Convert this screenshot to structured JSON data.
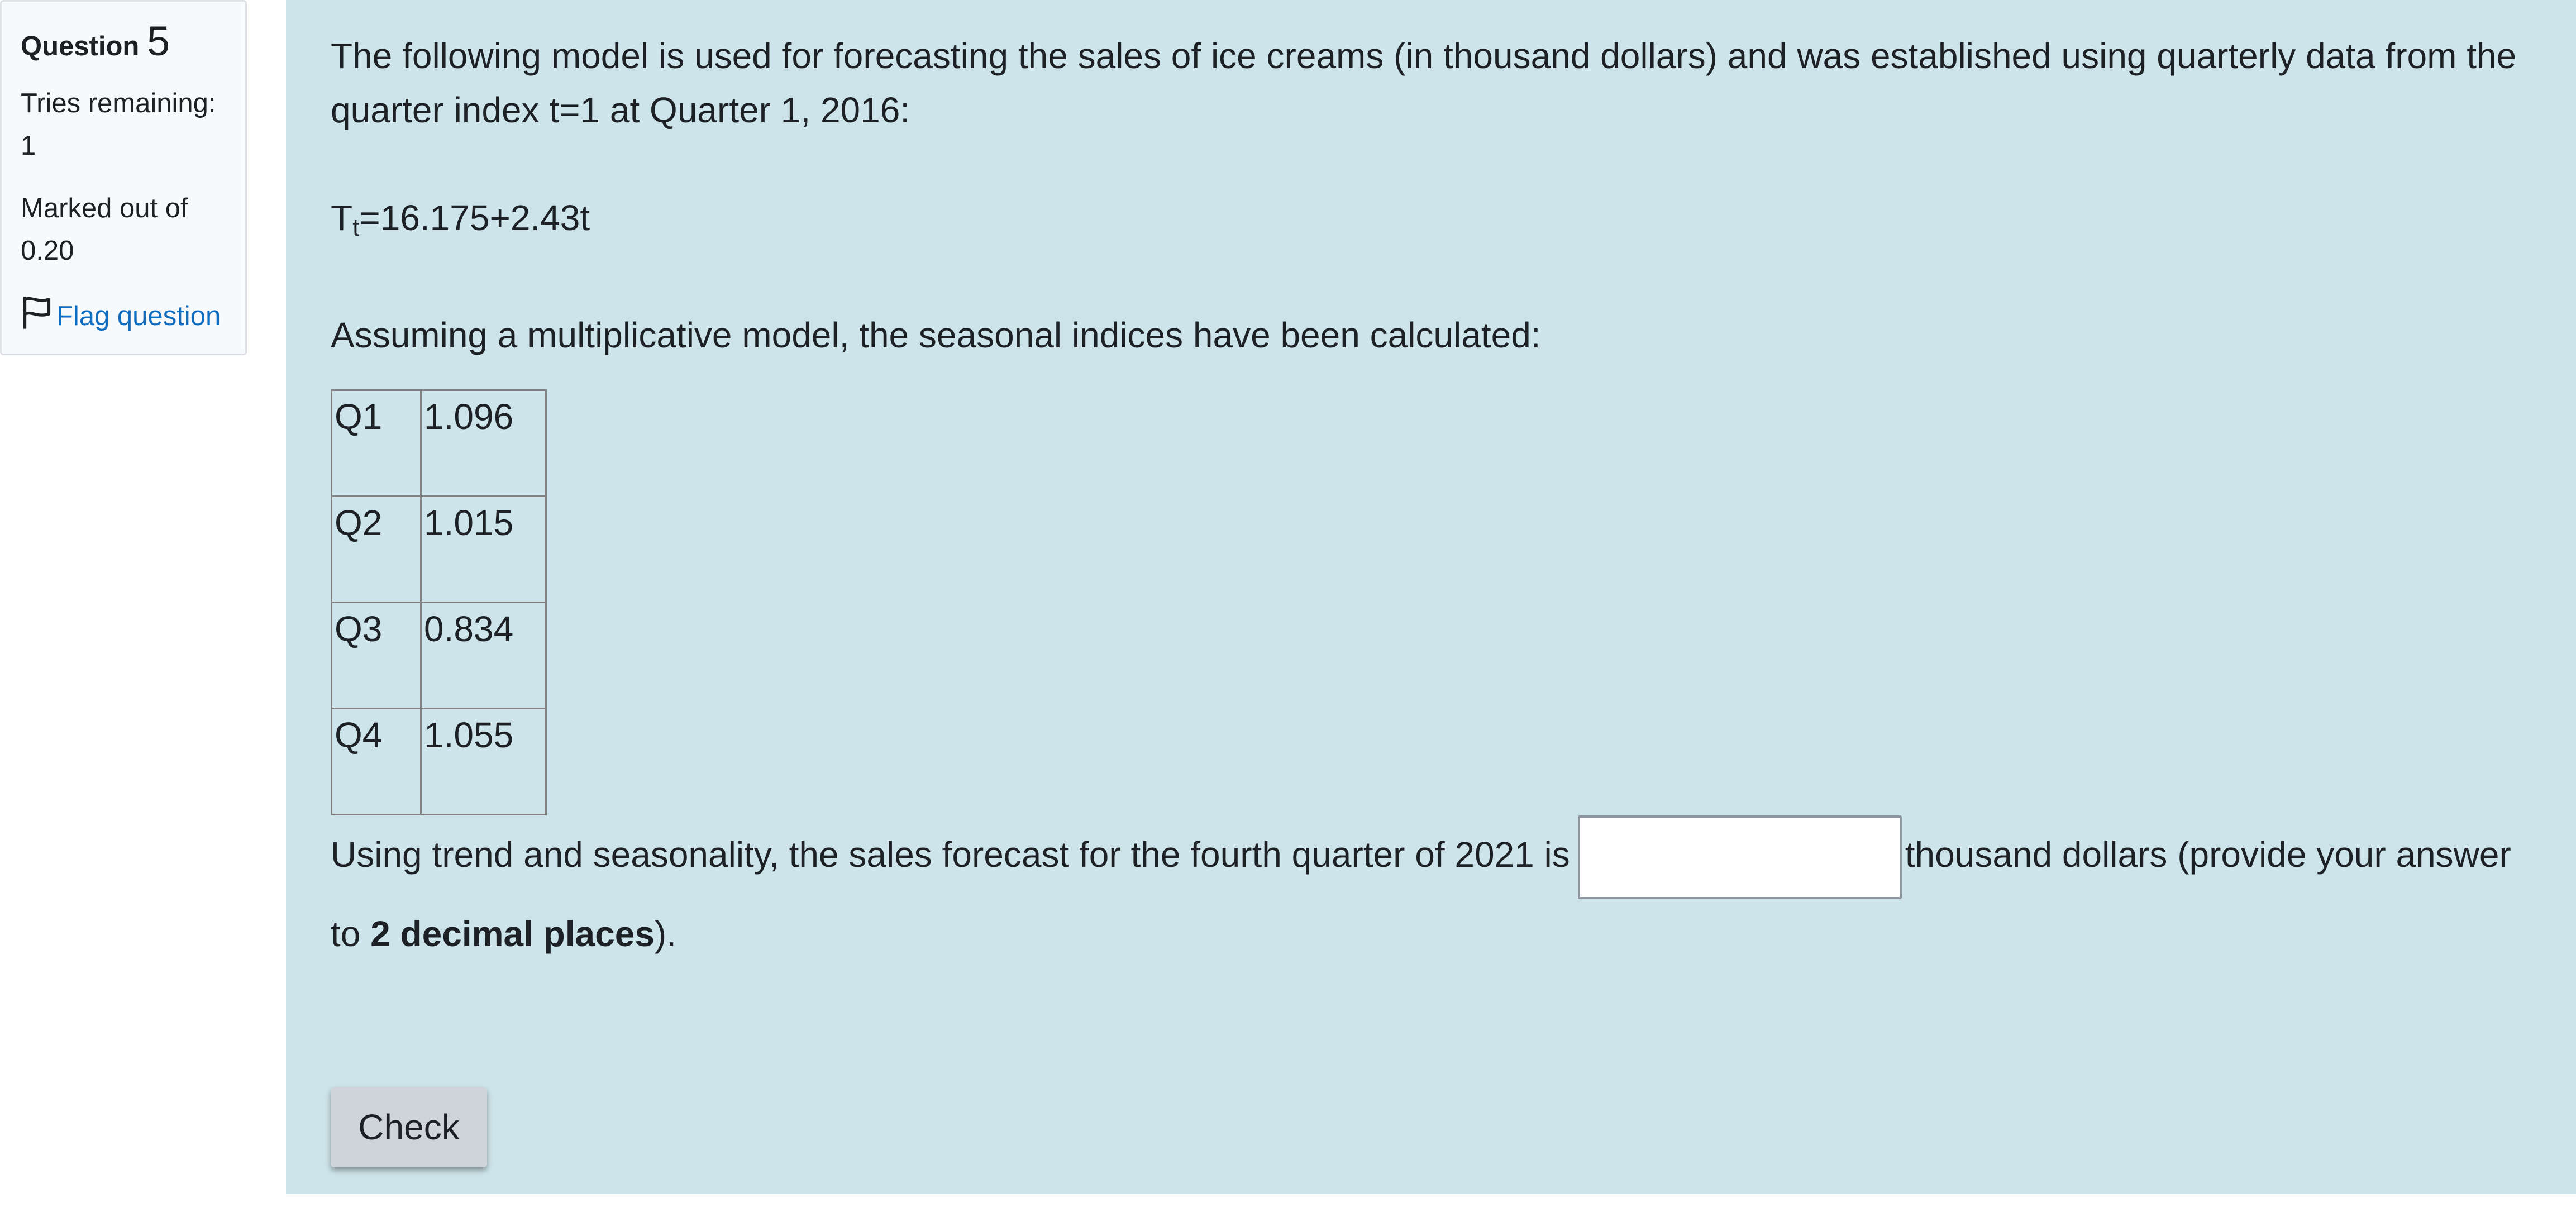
{
  "info": {
    "question_label": "Question",
    "question_number": "5",
    "tries_label": "Tries remaining:",
    "tries_value": "1",
    "marked_label": "Marked out of",
    "marked_value": "0.20",
    "flag_label": "Flag question"
  },
  "question": {
    "intro_text": "The following model is used for forecasting the sales of ice creams (in thousand dollars) and was established using quarterly data from the quarter index t=1 at Quarter 1, 2016:",
    "formula_T": "T",
    "formula_sub": "t",
    "formula_rest": "=16.175+2.43t",
    "seasonal_text": "Assuming a multiplicative model, the seasonal indices have been calculated:",
    "seasonal_table": [
      {
        "quarter": "Q1",
        "index": "1.096"
      },
      {
        "quarter": "Q2",
        "index": "1.015"
      },
      {
        "quarter": "Q3",
        "index": "0.834"
      },
      {
        "quarter": "Q4",
        "index": "1.055"
      }
    ],
    "answer_prefix": "Using trend and seasonality, the sales forecast for the fourth quarter of 2021 is",
    "answer_value": "",
    "answer_suffix_1": "thousand dollars (provide your answer",
    "answer_suffix_2_pre": "to ",
    "answer_suffix_2_bold": "2 decimal places",
    "answer_suffix_2_post": ")."
  },
  "actions": {
    "check_label": "Check"
  },
  "colors": {
    "content_background": "#cde5ea",
    "info_background": "#f8f9fa",
    "link": "#0f6cbf",
    "button_background": "#ced4da"
  },
  "icons": {
    "flag": "flag-icon"
  }
}
